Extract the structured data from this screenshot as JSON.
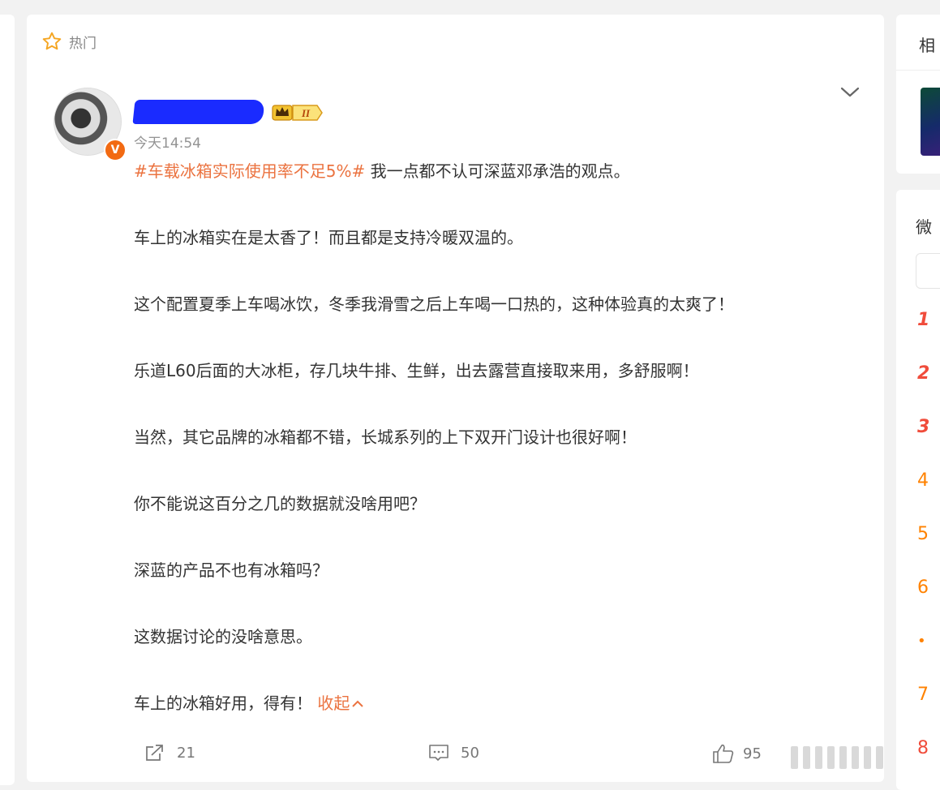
{
  "post": {
    "section_label": "热门",
    "timestamp": "今天14:54",
    "verified_mark": "V",
    "badge_level": "II",
    "hashtag": "#车载冰箱实际使用率不足5%#",
    "lines": [
      " 我一点都不认可深蓝邓承浩的观点。",
      "车上的冰箱实在是太香了！而且都是支持冷暖双温的。",
      "这个配置夏季上车喝冰饮，冬季我滑雪之后上车喝一口热的，这种体验真的太爽了！",
      "乐道L60后面的大冰柜，存几块牛排、生鲜，出去露营直接取来用，多舒服啊！",
      "当然，其它品牌的冰箱都不错，长城系列的上下双开门设计也很好啊！",
      "你不能说这百分之几的数据就没啥用吧？",
      "深蓝的产品不也有冰箱吗？",
      "这数据讨论的没啥意思。",
      "车上的冰箱好用，得有！ "
    ],
    "collapse_label": "收起",
    "actions": {
      "repost_count": "21",
      "comment_count": "50",
      "like_count": "95"
    }
  },
  "sidebar": {
    "card1_title": "相",
    "card2_title": "微",
    "ranks": [
      "1",
      "2",
      "3",
      "4",
      "5",
      "6",
      "•",
      "7",
      "8"
    ]
  },
  "colors": {
    "accent": "#eb7340",
    "verified": "#f26a12",
    "rank_top": "#f04c3b",
    "rank": "#ff8200"
  }
}
